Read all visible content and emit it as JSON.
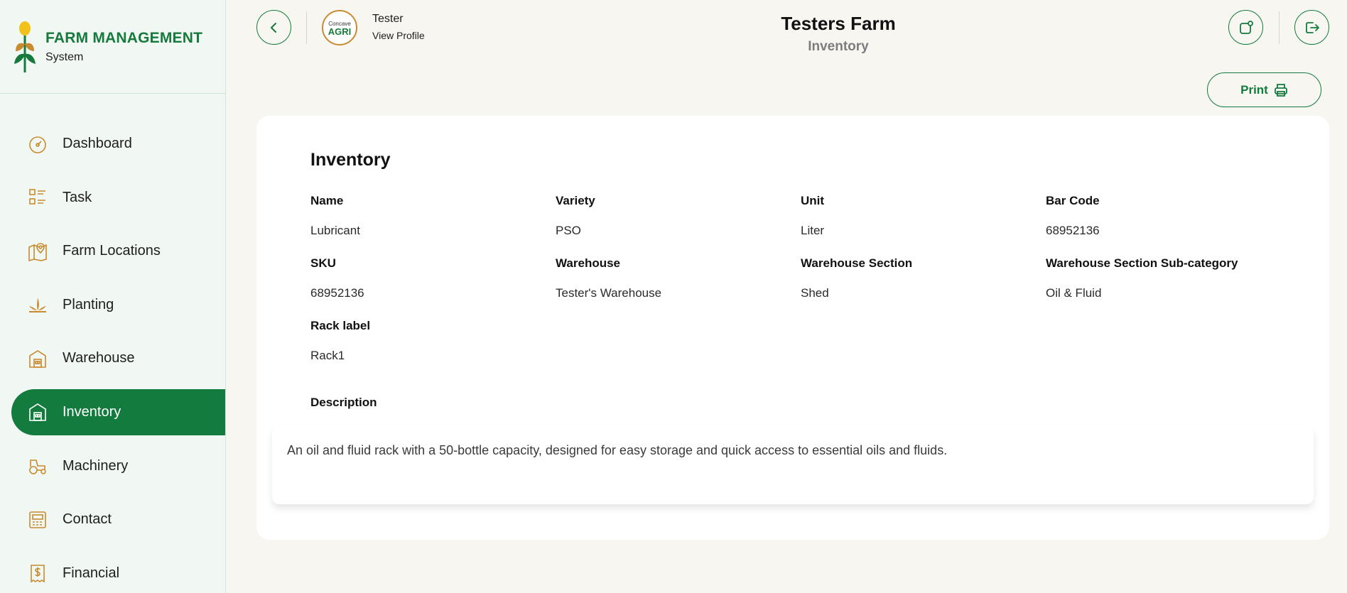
{
  "brand": {
    "title": "FARM MANAGEMENT",
    "subtitle": "System"
  },
  "sidebar": {
    "items": [
      {
        "label": "Dashboard",
        "icon": "dashboard-icon"
      },
      {
        "label": "Task",
        "icon": "task-list-icon"
      },
      {
        "label": "Farm Locations",
        "icon": "map-pin-icon"
      },
      {
        "label": "Planting",
        "icon": "plant-icon"
      },
      {
        "label": "Warehouse",
        "icon": "warehouse-icon"
      },
      {
        "label": "Inventory",
        "icon": "inventory-icon",
        "active": true
      },
      {
        "label": "Machinery",
        "icon": "tractor-icon"
      },
      {
        "label": "Contact",
        "icon": "contact-icon"
      },
      {
        "label": "Financial",
        "icon": "receipt-dollar-icon"
      }
    ]
  },
  "header": {
    "user_name": "Tester",
    "view_profile": "View Profile",
    "avatar_text_top": "Concave",
    "avatar_text_bottom": "AGRI",
    "farm_title": "Testers Farm",
    "page_subtitle": "Inventory"
  },
  "actions": {
    "print_label": "Print"
  },
  "inventory": {
    "title": "Inventory",
    "fields": {
      "name": {
        "label": "Name",
        "value": "Lubricant"
      },
      "variety": {
        "label": "Variety",
        "value": "PSO"
      },
      "unit": {
        "label": "Unit",
        "value": "Liter"
      },
      "bar_code": {
        "label": "Bar Code",
        "value": "68952136"
      },
      "sku": {
        "label": "SKU",
        "value": "68952136"
      },
      "warehouse": {
        "label": "Warehouse",
        "value": "Tester's Warehouse"
      },
      "warehouse_section": {
        "label": "Warehouse Section",
        "value": "Shed"
      },
      "warehouse_subcategory": {
        "label": "Warehouse Section Sub-category",
        "value": "Oil & Fluid"
      },
      "rack_label": {
        "label": "Rack label",
        "value": "Rack1"
      }
    },
    "description_label": "Description",
    "description": "An oil and fluid rack with a 50-bottle capacity, designed for easy storage and quick access to essential oils and fluids."
  },
  "colors": {
    "primary": "#137b3e",
    "accent_icon": "#c98b2f",
    "sidebar_bg": "#f1f7f2",
    "page_bg": "#f7f6f1"
  }
}
